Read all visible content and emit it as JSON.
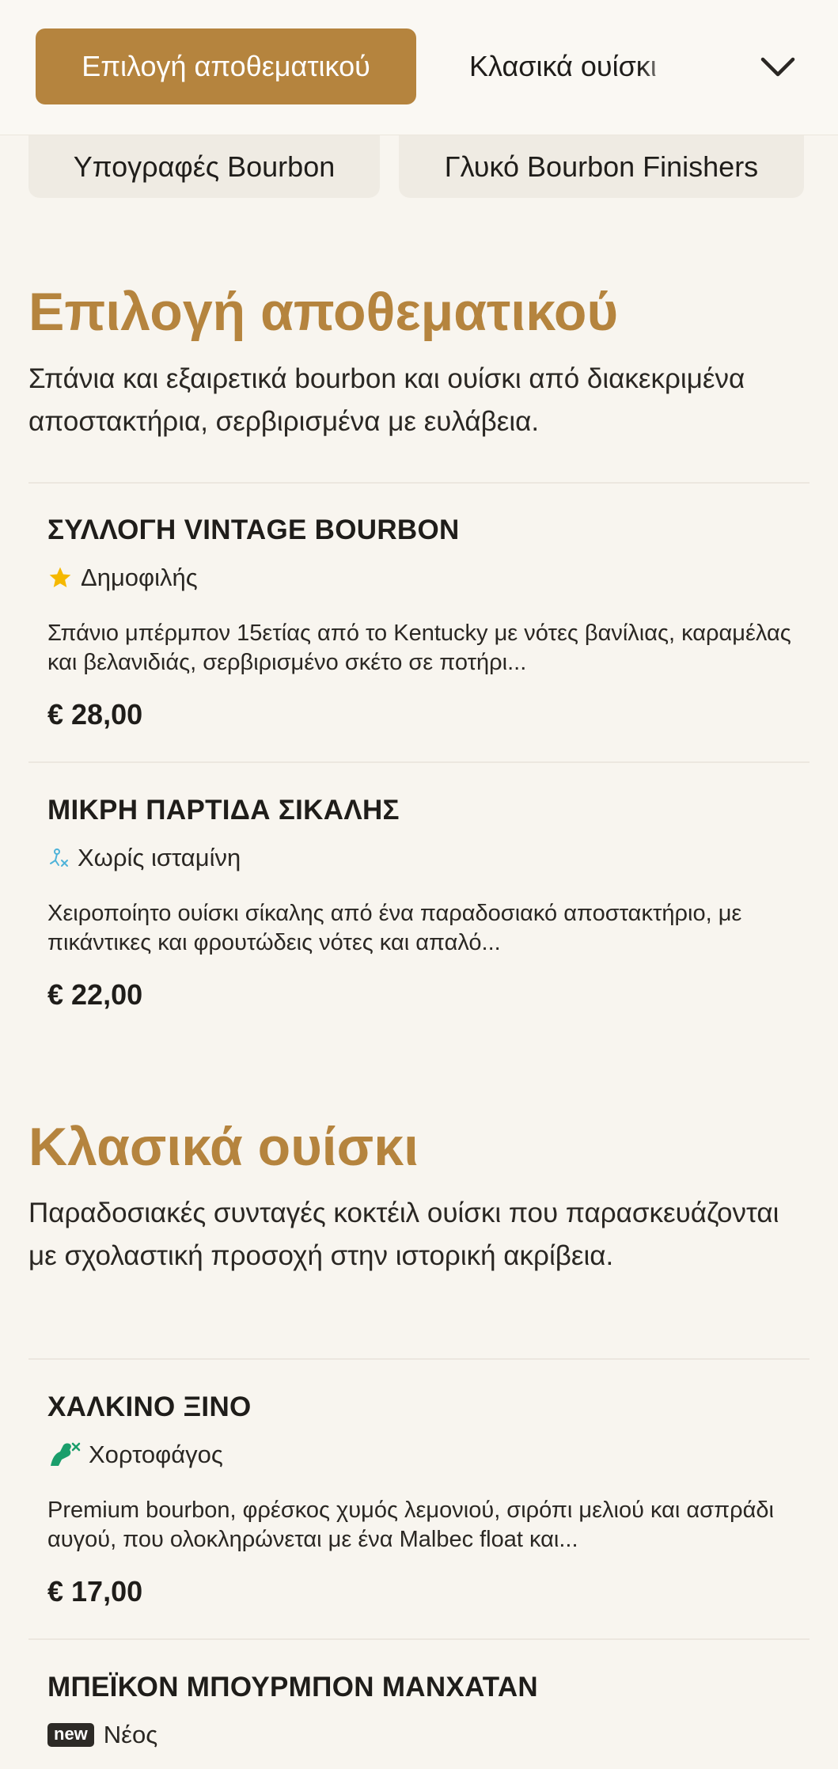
{
  "nav": {
    "active_tab": "Επιλογή αποθεματικού",
    "next_tab": "Κλασικά ουίσκι",
    "subcategories": [
      "Υπογραφές Bourbon",
      "Γλυκό Bourbon Finishers"
    ]
  },
  "sections": [
    {
      "title": "Επιλογή αποθεματικού",
      "description": "Σπάνια και εξαιρετικά bourbon και ουίσκι από διακεκριμένα αποστακτήρια, σερβιρισμένα με ευλάβεια.",
      "items": [
        {
          "name": "ΣΥΛΛΟΓΗ VINTAGE BOURBON",
          "tag": "Δημοφιλής",
          "tag_icon": "star-icon",
          "description": "Σπάνιο μπέρμπον 15ετίας από το Kentucky με νότες βανίλιας, καραμέλας και βελανιδιάς, σερβιρισμένο σκέτο σε ποτήρι...",
          "price": "€ 28,00"
        },
        {
          "name": "ΜΙΚΡΗ ΠΑΡΤΙΔΑ ΣΙΚΑΛΗΣ",
          "tag": "Χωρίς ισταμίνη",
          "tag_icon": "histamine-free-icon",
          "description": "Χειροποίητο ουίσκι σίκαλης από ένα παραδοσιακό αποστακτήριο, με πικάντικες και φρουτώδεις νότες και απαλό...",
          "price": "€ 22,00"
        }
      ]
    },
    {
      "title": "Κλασικά ουίσκι",
      "description": "Παραδοσιακές συνταγές κοκτέιλ ουίσκι που παρασκευάζονται με σχολαστική προσοχή στην ιστορική ακρίβεια.",
      "items": [
        {
          "name": "ΧΑΛΚΙΝΟ ΞΙΝΟ",
          "tag": "Χορτοφάγος",
          "tag_icon": "vegetarian-icon",
          "description": "Premium bourbon, φρέσκος χυμός λεμονιού, σιρόπι μελιού και ασπράδι αυγού, που ολοκληρώνεται με ένα Malbec float και...",
          "price": "€ 17,00"
        },
        {
          "name": "ΜΠΕΪΚΟΝ ΜΠΟΥΡΜΠΟΝ ΜΑΝΧΑΤΑΝ",
          "tag": "Νέος",
          "tag_icon": "new-badge-icon",
          "badge_text": "new"
        }
      ]
    }
  ],
  "colors": {
    "accent": "#b5843e",
    "background": "#f8f5ef",
    "star": "#f5b800",
    "vegetarian": "#1a9e6b",
    "histamine": "#4fb3d9"
  }
}
